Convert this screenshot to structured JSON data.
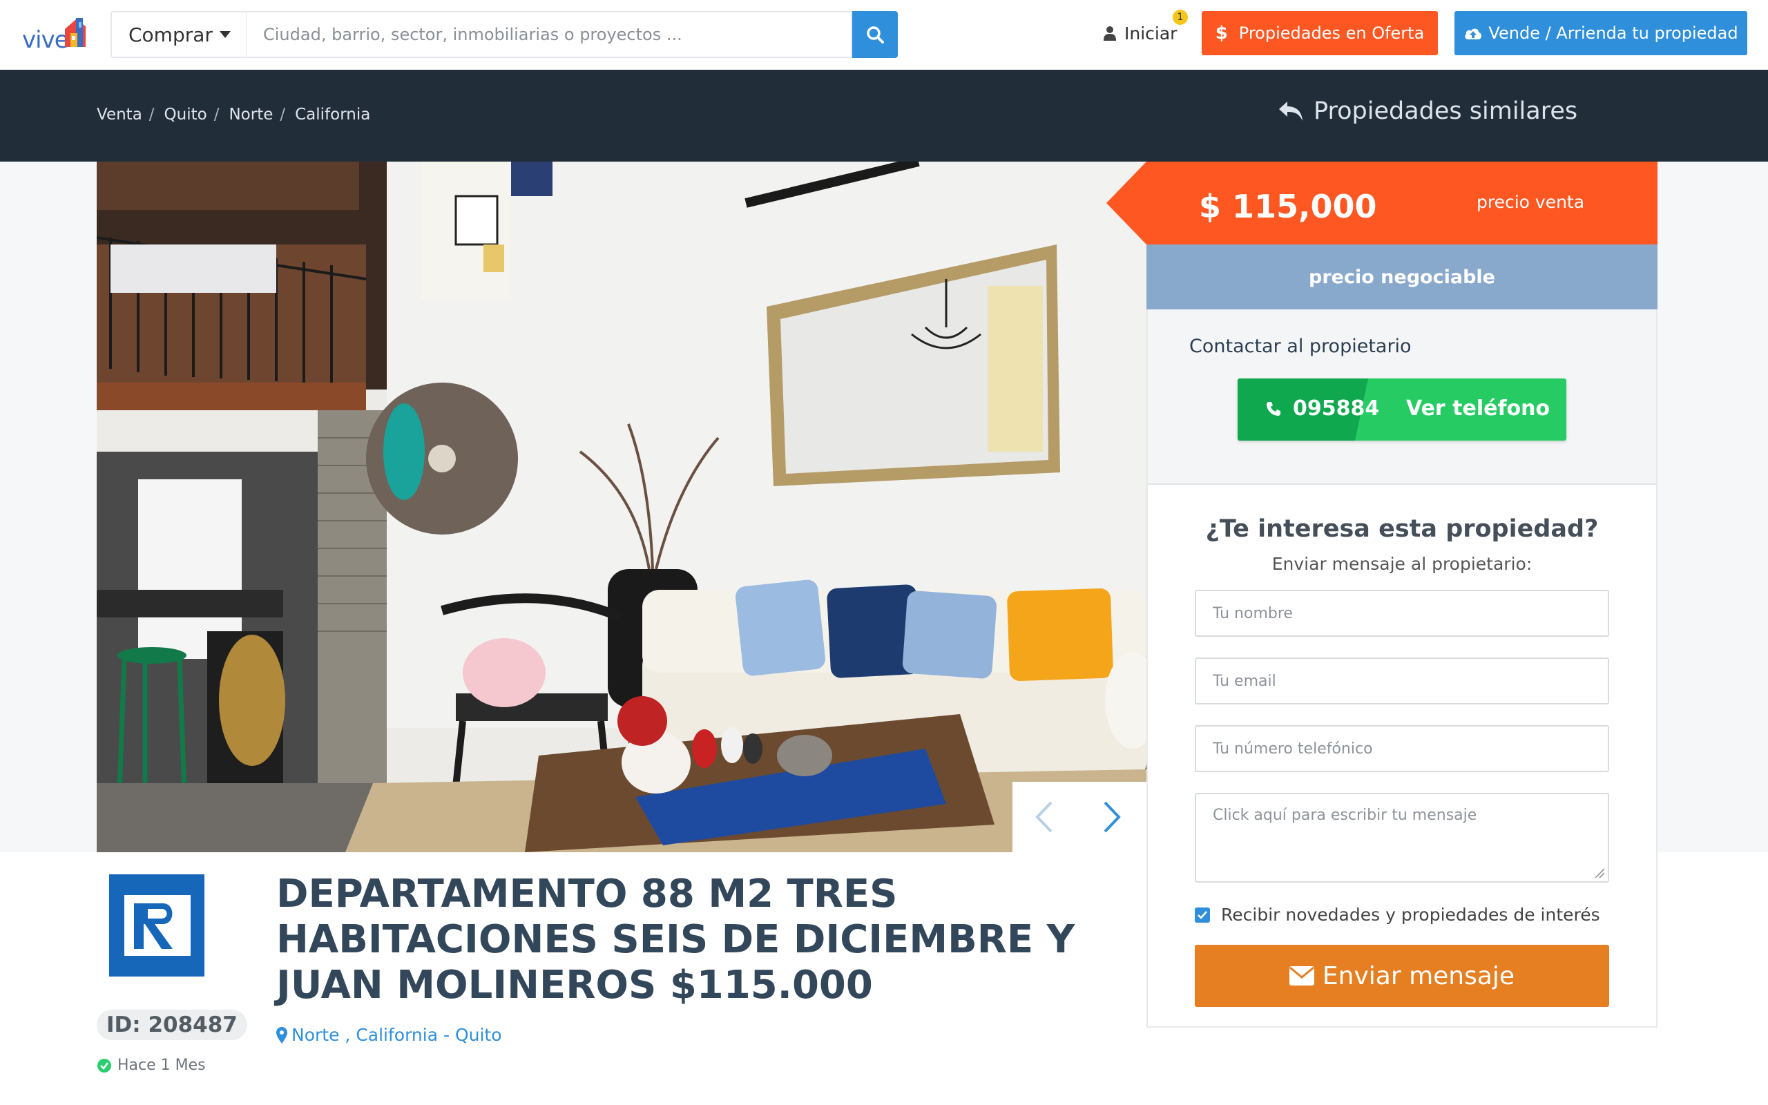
{
  "header": {
    "logo_text": "vive",
    "search": {
      "mode_label": "Comprar",
      "placeholder": "Ciudad, barrio, sector, inmobiliarias o proyectos ..."
    },
    "login_label": "Iniciar",
    "notification_count": "1",
    "offers_label": "Propiedades en Oferta",
    "offers_symbol": "$",
    "sell_label": "Vende / Arrienda tu propiedad"
  },
  "breadcrumb": {
    "items": [
      "Venta",
      "Quito",
      "Norte",
      "California"
    ],
    "separator": "/"
  },
  "similar_label": "Propiedades similares",
  "price": {
    "amount": "$ 115,000",
    "label": "precio venta",
    "negotiable": "precio negociable"
  },
  "contact": {
    "title": "Contactar al propietario",
    "phone_partial": "095884",
    "see_phone_label": "Ver teléfono"
  },
  "form": {
    "title": "¿Te interesa esta propiedad?",
    "subtitle": "Enviar mensaje al propietario:",
    "name_placeholder": "Tu nombre",
    "email_placeholder": "Tu email",
    "phone_placeholder": "Tu número telefónico",
    "message_placeholder": "Click aquí para escribir tu mensaje",
    "subscribe_label": "Recibir novedades y propiedades de interés",
    "subscribe_checked": true,
    "send_label": "Enviar mensaje"
  },
  "listing": {
    "title": "DEPARTAMENTO 88 M2 TRES HABITACIONES SEIS DE DICIEMBRE Y JUAN MOLINEROS $115.000",
    "id_label": "ID: 208487",
    "age_label": "Hace 1 Mes",
    "location": {
      "sector": "Norte",
      "separator": " , ",
      "neighborhood": "California",
      "dash": " - ",
      "city": "Quito"
    }
  },
  "colors": {
    "brand_blue": "#2f8fdb",
    "offer_orange": "#ff5722",
    "dark_bar": "#222d3a",
    "negotiable_blue": "#89a9cc",
    "phone_green": "#26cc63",
    "send_orange": "#e67e22"
  },
  "icons": {
    "search": "search-icon",
    "user": "user-icon",
    "dollar": "dollar-icon",
    "cloud_upload": "cloud-upload-icon",
    "reply": "reply-icon",
    "phone": "phone-icon",
    "envelope": "envelope-icon",
    "map_pin": "map-pin-icon",
    "check_circle": "check-circle-icon",
    "chevron_left": "chevron-left-icon",
    "chevron_right": "chevron-right-icon"
  }
}
